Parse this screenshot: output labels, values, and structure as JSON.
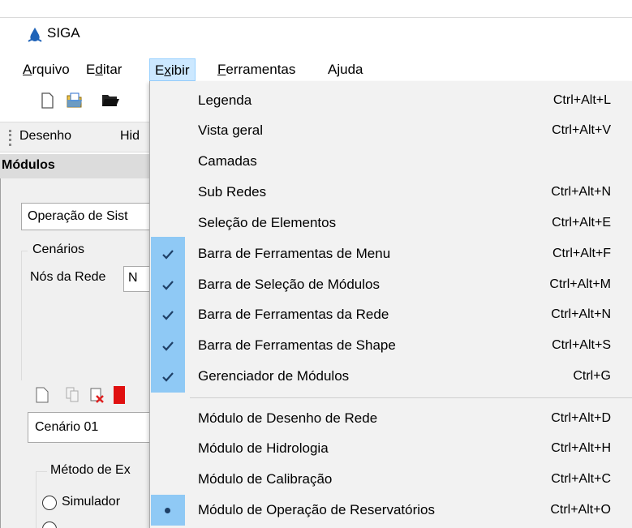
{
  "window": {
    "title": "SIGA"
  },
  "menubar": [
    {
      "mnemonic": "A",
      "rest": "rquivo",
      "open": false
    },
    {
      "pre": "E",
      "mnemonic": "d",
      "rest": "itar",
      "open": false
    },
    {
      "pre": "E",
      "mnemonic": "x",
      "rest": "ibir",
      "open": true
    },
    {
      "mnemonic": "F",
      "rest": "erramentas",
      "open": false
    },
    {
      "text": "Ajuda",
      "open": false
    }
  ],
  "module_bar": {
    "buttons": [
      "Desenho",
      "Hid"
    ]
  },
  "panel": {
    "header": "Módulos",
    "combo_value": "Operação de Sist",
    "group_label": "Cenários",
    "nos_label": "Nós da Rede",
    "nos_value": "N",
    "scenario_value": "Cenário 01",
    "method_label": "Método de Ex",
    "radio_label": "Simulador"
  },
  "dropdown": {
    "items": [
      {
        "label": "Legenda",
        "shortcut": "Ctrl+Alt+L",
        "mark": ""
      },
      {
        "label": "Vista geral",
        "shortcut": "Ctrl+Alt+V",
        "mark": ""
      },
      {
        "label": "Camadas",
        "shortcut": "",
        "mark": ""
      },
      {
        "label": "Sub Redes",
        "shortcut": "Ctrl+Alt+N",
        "mark": ""
      },
      {
        "label": "Seleção de Elementos",
        "shortcut": "Ctrl+Alt+E",
        "mark": ""
      },
      {
        "label": "Barra de Ferramentas de Menu",
        "shortcut": "Ctrl+Alt+F",
        "mark": "check"
      },
      {
        "label": "Barra de Seleção de Módulos",
        "shortcut": "Ctrl+Alt+M",
        "mark": "check"
      },
      {
        "label": "Barra de Ferramentas da Rede",
        "shortcut": "Ctrl+Alt+N",
        "mark": "check"
      },
      {
        "label": "Barra de Ferramentas de Shape",
        "shortcut": "Ctrl+Alt+S",
        "mark": "check"
      },
      {
        "label": "Gerenciador de Módulos",
        "shortcut": "Ctrl+G",
        "mark": "check"
      },
      {
        "label": "Módulo de Desenho de Rede",
        "shortcut": "Ctrl+Alt+D",
        "mark": ""
      },
      {
        "label": "Módulo de Hidrologia",
        "shortcut": "Ctrl+Alt+H",
        "mark": ""
      },
      {
        "label": "Módulo de Calibração",
        "shortcut": "Ctrl+Alt+C",
        "mark": ""
      },
      {
        "label": "Módulo de Operação de Reservatórios",
        "shortcut": "Ctrl+Alt+O",
        "mark": "bullet"
      }
    ]
  },
  "colors": {
    "highlight": "#8fc9f5",
    "menu_open_bg": "#cce8ff",
    "menu_bg": "#f2f2f2",
    "check": "#1e3f66"
  }
}
